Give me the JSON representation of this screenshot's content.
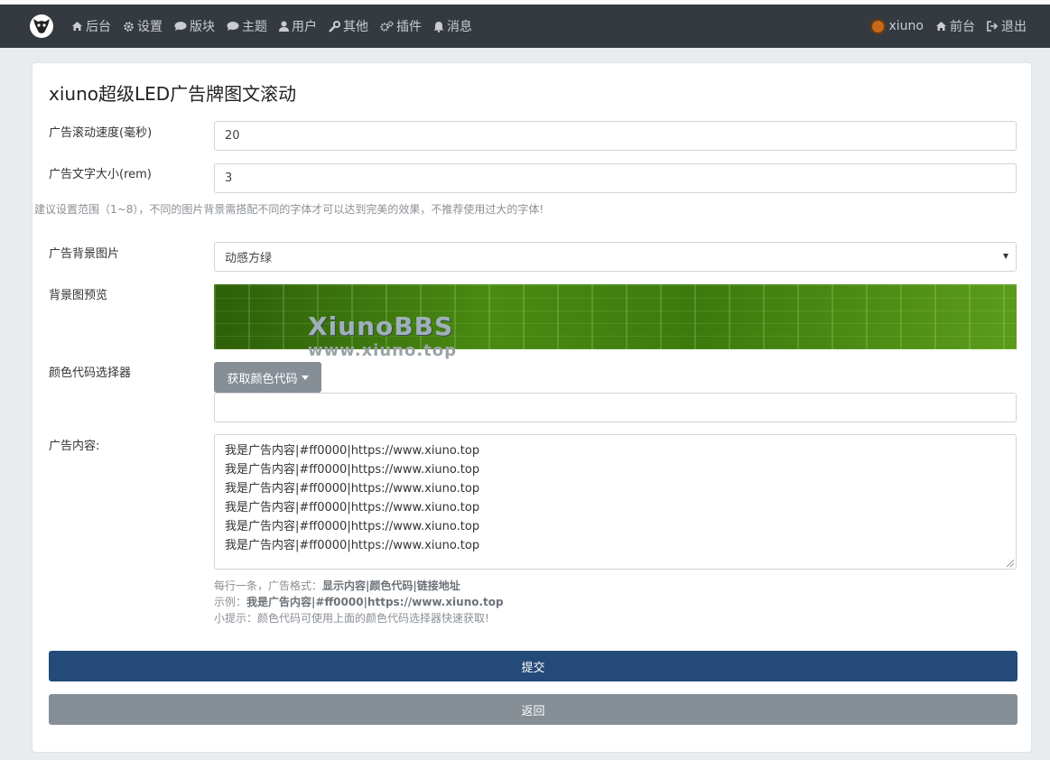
{
  "navbar": {
    "left_items": [
      {
        "label": "后台",
        "icon": "home-icon"
      },
      {
        "label": "设置",
        "icon": "gear-icon"
      },
      {
        "label": "版块",
        "icon": "comment-icon"
      },
      {
        "label": "主题",
        "icon": "comment-icon"
      },
      {
        "label": "用户",
        "icon": "user-icon"
      },
      {
        "label": "其他",
        "icon": "wrench-icon"
      },
      {
        "label": "插件",
        "icon": "cogs-icon"
      },
      {
        "label": "消息",
        "icon": "bell-icon"
      }
    ],
    "right_items": [
      {
        "label": "xiuno",
        "icon": "avatar"
      },
      {
        "label": "前台",
        "icon": "home-icon"
      },
      {
        "label": "退出",
        "icon": "sign-out-icon"
      }
    ]
  },
  "page": {
    "title": "xiuno超级LED广告牌图文滚动"
  },
  "form": {
    "speed": {
      "label": "广告滚动速度(毫秒)",
      "value": "20"
    },
    "font_size": {
      "label": "广告文字大小(rem)",
      "value": "3"
    },
    "font_size_help": "建议设置范围（1~8），不同的图片背景需搭配不同的字体才可以达到完美的效果，不推荐使用过大的字体!",
    "background": {
      "label": "广告背景图片",
      "selected": "动感方绿"
    },
    "preview": {
      "label": "背景图预览",
      "watermark_title": "XiunoBBS",
      "watermark_url": "www.xiuno.top"
    },
    "color_picker": {
      "label": "颜色代码选择器",
      "button_label": "获取颜色代码",
      "value": ""
    },
    "content": {
      "label": "广告内容:",
      "lines": [
        "我是广告内容|#ff0000|https://www.xiuno.top",
        "我是广告内容|#ff0000|https://www.xiuno.top",
        "我是广告内容|#ff0000|https://www.xiuno.top",
        "我是广告内容|#ff0000|https://www.xiuno.top",
        "我是广告内容|#ff0000|https://www.xiuno.top",
        "我是广告内容|#ff0000|https://www.xiuno.top"
      ]
    },
    "hints": {
      "line1_prefix": "每行一条，广告格式：",
      "line1_bold": "显示内容|颜色代码|链接地址",
      "line2_prefix": "示例：",
      "line2_bold": "我是广告内容|#ff0000|https://www.xiuno.top",
      "line3": "小提示：颜色代码可使用上面的颜色代码选择器快速获取!"
    },
    "submit_label": "提交",
    "back_label": "返回"
  },
  "colors": {
    "navbar_bg": "#343a40",
    "primary": "#234a78",
    "secondary": "#868e96",
    "page_bg": "#e9ecef"
  }
}
